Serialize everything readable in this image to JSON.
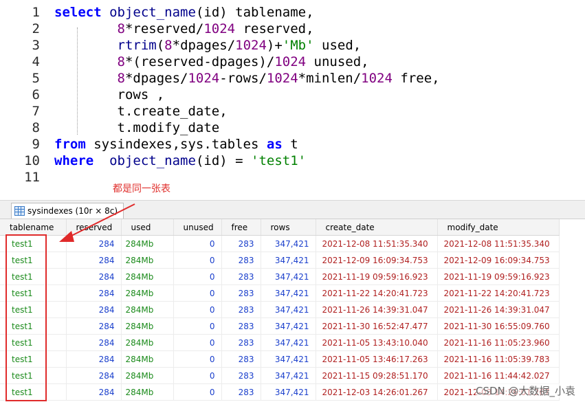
{
  "editor": {
    "lines": [
      {
        "num": "1",
        "tokens": [
          {
            "t": "select",
            "c": "kw"
          },
          {
            "t": " ",
            "c": ""
          },
          {
            "t": "object_name",
            "c": "fn"
          },
          {
            "t": "(id) tablename,",
            "c": ""
          }
        ]
      },
      {
        "num": "2",
        "tokens": [
          {
            "t": "        ",
            "c": ""
          },
          {
            "t": "8",
            "c": "num"
          },
          {
            "t": "*reserved/",
            "c": ""
          },
          {
            "t": "1024",
            "c": "num"
          },
          {
            "t": " reserved,",
            "c": ""
          }
        ]
      },
      {
        "num": "3",
        "tokens": [
          {
            "t": "        ",
            "c": ""
          },
          {
            "t": "rtrim",
            "c": "fn"
          },
          {
            "t": "(",
            "c": ""
          },
          {
            "t": "8",
            "c": "num"
          },
          {
            "t": "*dpages/",
            "c": ""
          },
          {
            "t": "1024",
            "c": "num"
          },
          {
            "t": ")+",
            "c": ""
          },
          {
            "t": "'Mb'",
            "c": "str"
          },
          {
            "t": " used,",
            "c": ""
          }
        ]
      },
      {
        "num": "4",
        "tokens": [
          {
            "t": "        ",
            "c": ""
          },
          {
            "t": "8",
            "c": "num"
          },
          {
            "t": "*(reserved-dpages)/",
            "c": ""
          },
          {
            "t": "1024",
            "c": "num"
          },
          {
            "t": " unused,",
            "c": ""
          }
        ]
      },
      {
        "num": "5",
        "tokens": [
          {
            "t": "        ",
            "c": ""
          },
          {
            "t": "8",
            "c": "num"
          },
          {
            "t": "*dpages/",
            "c": ""
          },
          {
            "t": "1024",
            "c": "num"
          },
          {
            "t": "-rows/",
            "c": ""
          },
          {
            "t": "1024",
            "c": "num"
          },
          {
            "t": "*minlen/",
            "c": ""
          },
          {
            "t": "1024",
            "c": "num"
          },
          {
            "t": " free,",
            "c": ""
          }
        ]
      },
      {
        "num": "6",
        "tokens": [
          {
            "t": "        rows ,",
            "c": ""
          }
        ]
      },
      {
        "num": "7",
        "tokens": [
          {
            "t": "        t.create_date,",
            "c": ""
          }
        ]
      },
      {
        "num": "8",
        "tokens": [
          {
            "t": "        t.modify_date",
            "c": ""
          }
        ]
      },
      {
        "num": "9",
        "tokens": [
          {
            "t": "from",
            "c": "kw"
          },
          {
            "t": " sysindexes,sys.tables ",
            "c": ""
          },
          {
            "t": "as",
            "c": "kw"
          },
          {
            "t": " t",
            "c": ""
          }
        ]
      },
      {
        "num": "10",
        "tokens": [
          {
            "t": "where",
            "c": "kw"
          },
          {
            "t": "  ",
            "c": ""
          },
          {
            "t": "object_name",
            "c": "fn"
          },
          {
            "t": "(id) = ",
            "c": ""
          },
          {
            "t": "'test1'",
            "c": "str"
          }
        ]
      },
      {
        "num": "11",
        "tokens": []
      }
    ],
    "annotation": "都是同一张表"
  },
  "results": {
    "tab_label": "sysindexes (10r × 8c)",
    "columns": [
      "tablename",
      "reserved",
      "used",
      "unused",
      "free",
      "rows",
      "create_date",
      "modify_date"
    ],
    "rows": [
      [
        "test1",
        "284",
        "284Mb",
        "0",
        "283",
        "347,421",
        "2021-12-08 11:51:35.340",
        "2021-12-08 11:51:35.340"
      ],
      [
        "test1",
        "284",
        "284Mb",
        "0",
        "283",
        "347,421",
        "2021-12-09 16:09:34.753",
        "2021-12-09 16:09:34.753"
      ],
      [
        "test1",
        "284",
        "284Mb",
        "0",
        "283",
        "347,421",
        "2021-11-19 09:59:16.923",
        "2021-11-19 09:59:16.923"
      ],
      [
        "test1",
        "284",
        "284Mb",
        "0",
        "283",
        "347,421",
        "2021-11-22 14:20:41.723",
        "2021-11-22 14:20:41.723"
      ],
      [
        "test1",
        "284",
        "284Mb",
        "0",
        "283",
        "347,421",
        "2021-11-26 14:39:31.047",
        "2021-11-26 14:39:31.047"
      ],
      [
        "test1",
        "284",
        "284Mb",
        "0",
        "283",
        "347,421",
        "2021-11-30 16:52:47.477",
        "2021-11-30 16:55:09.760"
      ],
      [
        "test1",
        "284",
        "284Mb",
        "0",
        "283",
        "347,421",
        "2021-11-05 13:43:10.040",
        "2021-11-16 11:05:23.960"
      ],
      [
        "test1",
        "284",
        "284Mb",
        "0",
        "283",
        "347,421",
        "2021-11-05 13:46:17.263",
        "2021-11-16 11:05:39.783"
      ],
      [
        "test1",
        "284",
        "284Mb",
        "0",
        "283",
        "347,421",
        "2021-11-15 09:28:51.170",
        "2021-11-16 11:44:42.027"
      ],
      [
        "test1",
        "284",
        "284Mb",
        "0",
        "283",
        "347,421",
        "2021-12-03 14:26:01.267",
        "2021-12-03 14:26:01.267"
      ]
    ]
  },
  "watermark": "CSDN @大数据_小袁",
  "colors": {
    "highlight": "#e02a2a",
    "keyword": "#0000ff",
    "number": "#800080",
    "string": "#008000"
  }
}
